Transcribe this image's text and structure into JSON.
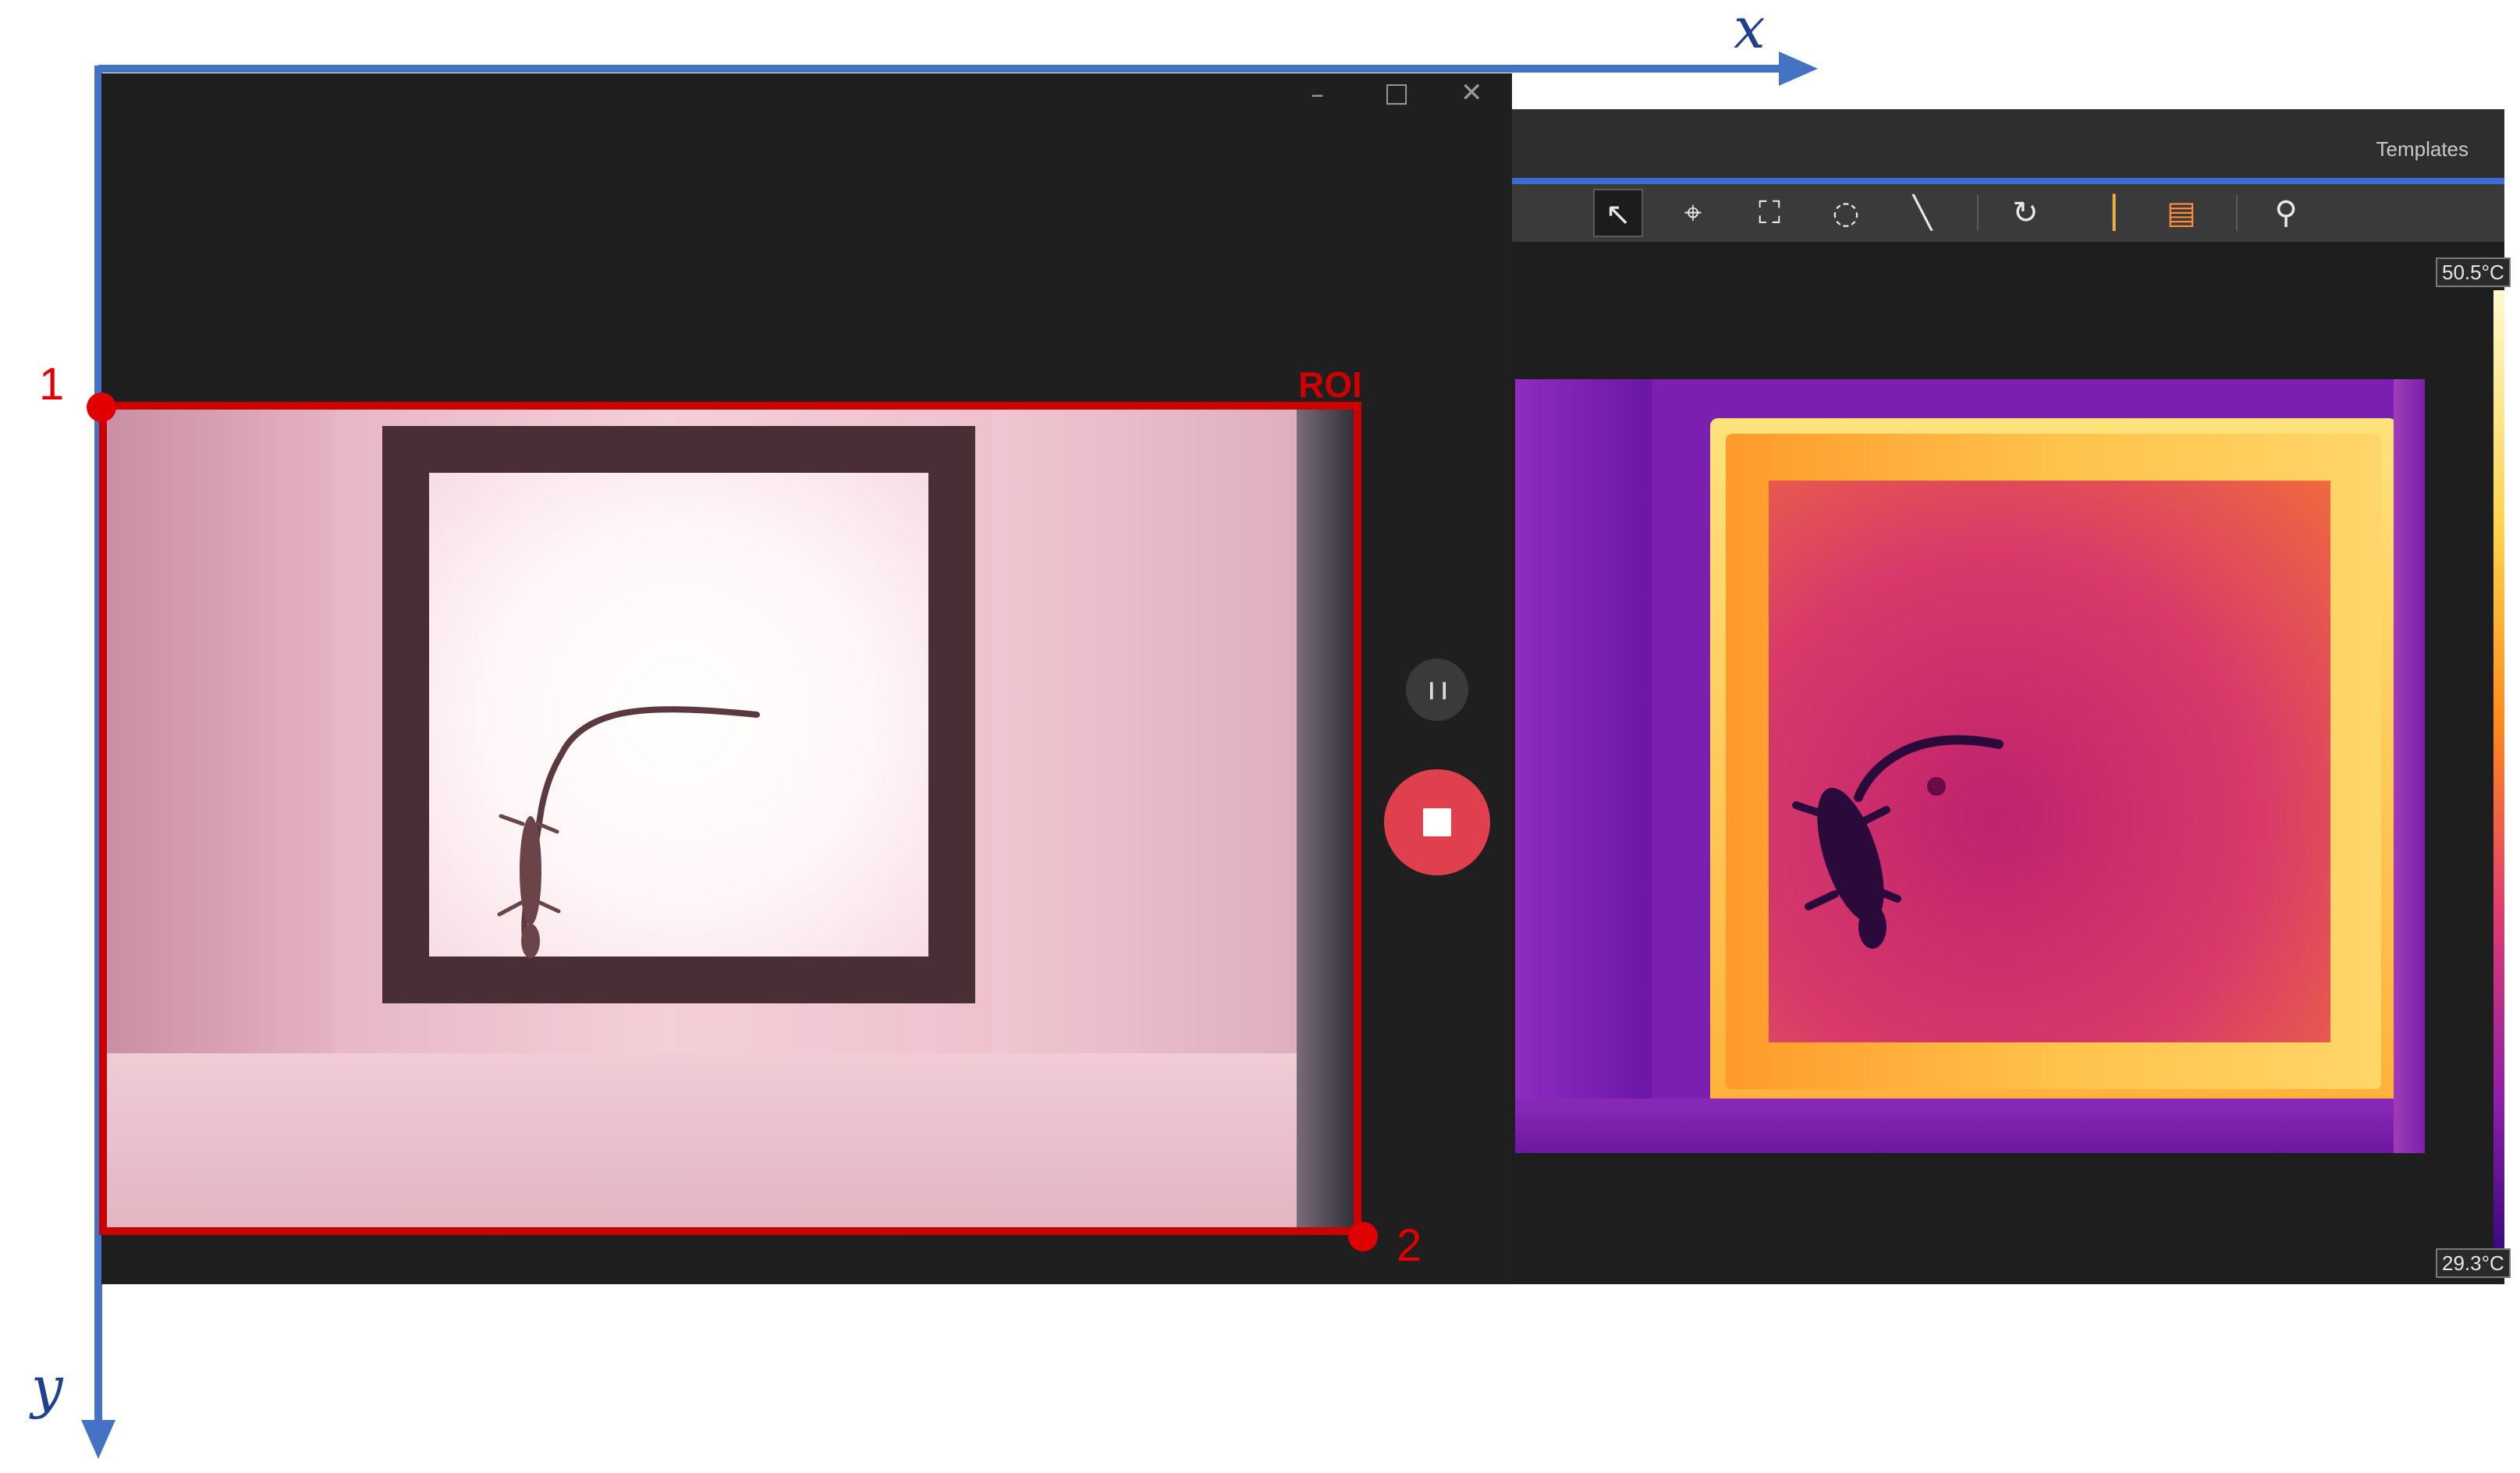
{
  "axes": {
    "x_label": "x",
    "y_label": "y"
  },
  "roi": {
    "label": "ROI",
    "corner_start": "1",
    "corner_end": "2"
  },
  "camera_window": {
    "controls": {
      "minimize": "–",
      "maximize": "□",
      "close": "✕"
    },
    "pause_icon": "❙❙"
  },
  "thermal_window": {
    "templates_label": "Templates",
    "temp_max": "50.5°C",
    "temp_min": "29.3°C",
    "toolbar": [
      {
        "icon": "select-arrow-icon",
        "glyph": "↖"
      },
      {
        "icon": "spot-icon",
        "glyph": "⌖"
      },
      {
        "icon": "box-icon",
        "glyph": "⛶"
      },
      {
        "icon": "circle-icon",
        "glyph": "◌"
      },
      {
        "icon": "line-icon",
        "glyph": "╲"
      },
      {
        "icon": "rotate-icon",
        "glyph": "↻"
      },
      {
        "icon": "palette-icon",
        "glyph": "▕"
      },
      {
        "icon": "image-icon",
        "glyph": "▤"
      },
      {
        "icon": "search-icon",
        "glyph": "⚲"
      }
    ]
  },
  "colors": {
    "axis": "#4472c4",
    "roi": "#cc0000",
    "stop_button": "#e0404e",
    "accent": "#3d6bd4"
  }
}
